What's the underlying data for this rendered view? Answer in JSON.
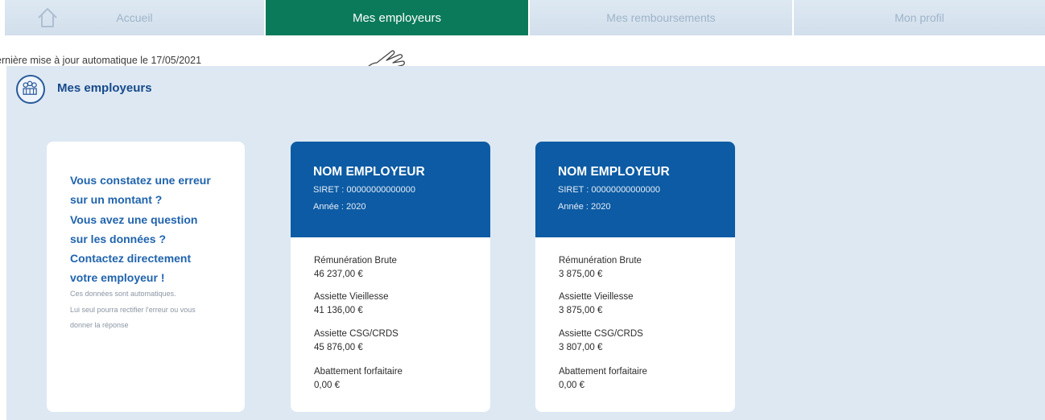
{
  "nav": {
    "tabs": [
      {
        "label": "Accueil",
        "icon": "home-icon",
        "active": false
      },
      {
        "label": "Mes employeurs",
        "active": true
      },
      {
        "label": "Mes remboursements",
        "active": false
      },
      {
        "label": "Mon profil",
        "active": false
      }
    ]
  },
  "update": {
    "text": "ernière mise à jour automatique le 17/05/2021"
  },
  "section": {
    "title": "Mes employeurs",
    "icon": "employers-group-icon"
  },
  "info": {
    "lines": [
      "Vous constatez une erreur",
      "sur un montant ?",
      "Vous avez une question",
      "sur les données ?",
      "Contactez directement",
      "votre employeur !"
    ],
    "note_lines": [
      "Ces données sont automatiques.",
      "Lui seul pourra rectifier l'erreur ou vous",
      "donner la réponse"
    ]
  },
  "employers": [
    {
      "name": "NOM EMPLOYEUR",
      "siret": "SIRET : 00000000000000",
      "year": "Année : 2020",
      "fields": [
        {
          "label": "Rémunération Brute",
          "value": "46 237,00 €"
        },
        {
          "label": "Assiette Vieillesse",
          "value": "41 136,00 €"
        },
        {
          "label": "Assiette CSG/CRDS",
          "value": "45 876,00 €"
        },
        {
          "label": "Abattement forfaitaire",
          "value": "0,00 €"
        }
      ]
    },
    {
      "name": "NOM EMPLOYEUR",
      "siret": "SIRET : 00000000000000",
      "year": "Année : 2020",
      "fields": [
        {
          "label": "Rémunération Brute",
          "value": "3 875,00 €"
        },
        {
          "label": "Assiette Vieillesse",
          "value": "3 875,00 €"
        },
        {
          "label": "Assiette CSG/CRDS",
          "value": "3 807,00 €"
        },
        {
          "label": "Abattement forfaitaire",
          "value": "0,00 €"
        }
      ]
    }
  ],
  "colors": {
    "active_tab": "#0b7a5a",
    "card_header": "#0c5ba4",
    "info_text": "#1f63ad",
    "background": "#dde8f3"
  }
}
